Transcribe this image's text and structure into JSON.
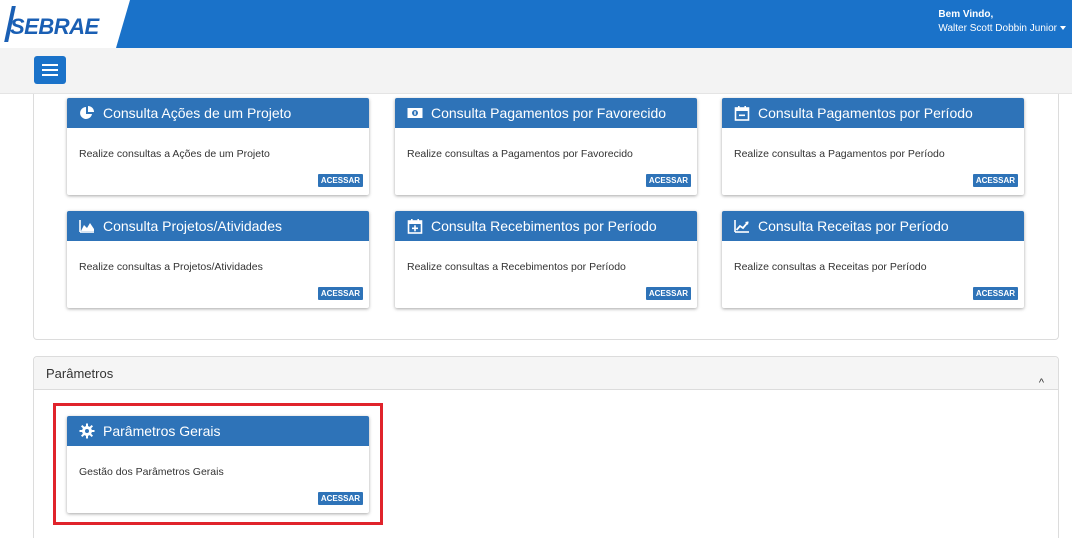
{
  "header": {
    "logo_text": "SEBRAE",
    "greeting": "Bem Vindo,",
    "user_name": "Walter Scott Dobbin Junior"
  },
  "colors": {
    "primary": "#1a72c9",
    "card_header": "#2e73b8",
    "highlight": "#e0232b"
  },
  "cards": [
    {
      "title": "Consulta Ações de um Projeto",
      "icon": "pie-chart-icon",
      "desc": "Realize consultas a Ações de um Projeto",
      "button": "ACESSAR"
    },
    {
      "title": "Consulta Pagamentos por Favorecido",
      "icon": "money-icon",
      "desc": "Realize consultas a Pagamentos por Favorecido",
      "button": "ACESSAR"
    },
    {
      "title": "Consulta Pagamentos por Período",
      "icon": "calendar-minus-icon",
      "desc": "Realize consultas a Pagamentos por Período",
      "button": "ACESSAR"
    },
    {
      "title": "Consulta Projetos/Atividades",
      "icon": "area-chart-icon",
      "desc": "Realize consultas a Projetos/Atividades",
      "button": "ACESSAR"
    },
    {
      "title": "Consulta Recebimentos por Período",
      "icon": "calendar-plus-icon",
      "desc": "Realize consultas a Recebimentos por Período",
      "button": "ACESSAR"
    },
    {
      "title": "Consulta Receitas por Período",
      "icon": "line-chart-icon",
      "desc": "Realize consultas a Receitas por Período",
      "button": "ACESSAR"
    }
  ],
  "parametros": {
    "section_title": "Parâmetros",
    "card": {
      "title": "Parâmetros Gerais",
      "icon": "gear-icon",
      "desc": "Gestão dos Parâmetros Gerais",
      "button": "ACESSAR"
    }
  }
}
